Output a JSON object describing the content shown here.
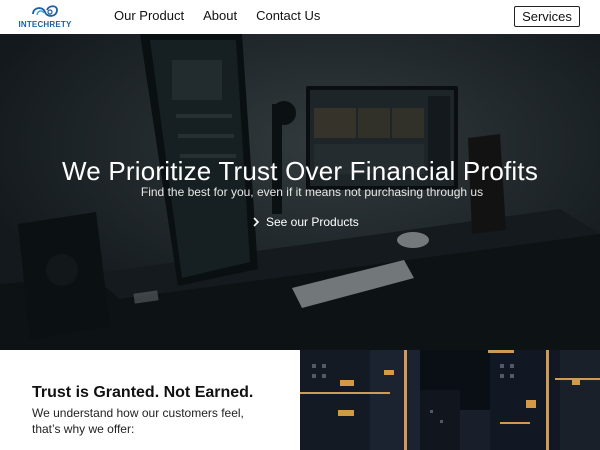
{
  "nav": {
    "logo_text": "INTECHRETY",
    "links": [
      "Our Product",
      "About",
      "Contact Us"
    ],
    "cta_label": "Services"
  },
  "hero": {
    "title": "We Prioritize Trust Over Financial Profits",
    "subtitle": "Find the best for you, even if it means not purchasing through us",
    "cta_label": "See our Products"
  },
  "section": {
    "title": "Trust is Granted. Not Earned.",
    "body": "We understand how our customers feel, that’s why we offer:"
  },
  "colors": {
    "brand": "#1d5fa8",
    "hero_text": "#ffffff"
  }
}
